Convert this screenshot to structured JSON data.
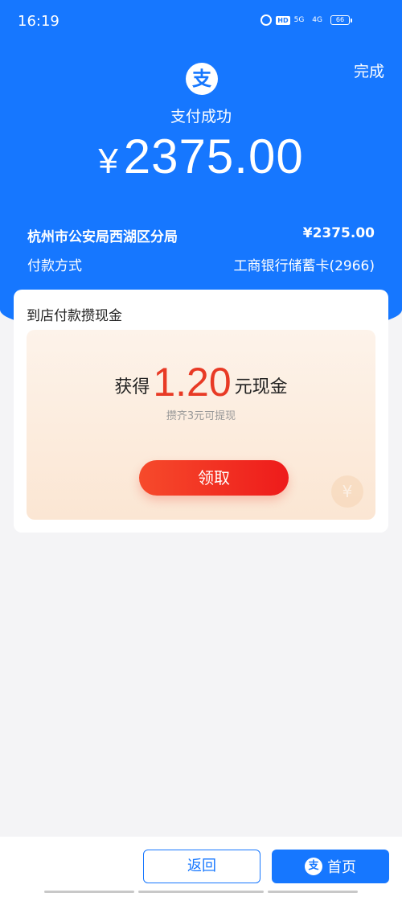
{
  "status_bar": {
    "time": "16:19",
    "battery": "66",
    "net1": "5G",
    "net2": "4G",
    "hd": "HD"
  },
  "header": {
    "done_label": "完成",
    "logo_glyph": "支",
    "success_text": "支付成功",
    "amount_symbol": "¥",
    "amount_value": "2375.00"
  },
  "details": {
    "merchant": "杭州市公安局西湖区分局",
    "merchant_amount": "¥2375.00",
    "payment_label": "付款方式",
    "payment_method": "工商银行储蓄卡(2966)"
  },
  "promo": {
    "card_title": "到店付款攒现金",
    "earn_prefix": "获得",
    "earn_amount": "1.20",
    "earn_suffix": "元现金",
    "sub_text": "攒齐3元可提现",
    "claim_label": "领取"
  },
  "footer": {
    "back_label": "返回",
    "home_label": "首页",
    "home_logo_glyph": "支"
  },
  "colors": {
    "brand": "#1677ff",
    "accent_red": "#e83a25"
  }
}
